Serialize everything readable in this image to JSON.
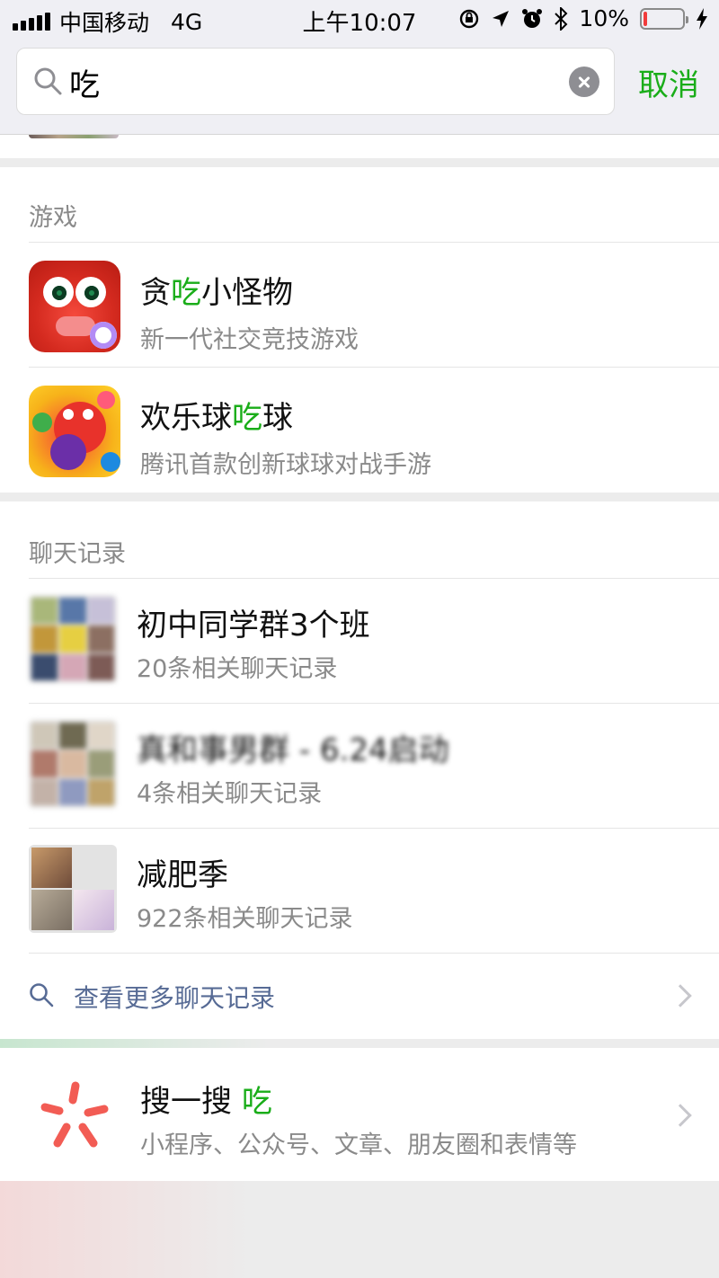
{
  "status_bar": {
    "carrier": "中国移动",
    "network": "4G",
    "time": "上午10:07",
    "battery": "10%",
    "battery_level": 0.1,
    "icons": [
      "signal-icon",
      "rotation-lock-icon",
      "location-icon",
      "alarm-icon",
      "bluetooth-icon",
      "battery-icon",
      "charging-icon"
    ]
  },
  "search": {
    "query": "吃",
    "cancel_label": "取消"
  },
  "games": {
    "title": "游戏",
    "items": [
      {
        "name_before": "贪",
        "name_highlight": "吃",
        "name_after": "小怪物",
        "desc": "新一代社交竞技游戏"
      },
      {
        "name_before": "欢乐球",
        "name_highlight": "吃",
        "name_after": "球",
        "desc": "腾讯首款创新球球对战手游"
      }
    ]
  },
  "chats": {
    "title": "聊天记录",
    "items": [
      {
        "name": "初中同学群3个班",
        "desc": "20条相关聊天记录"
      },
      {
        "name": "真和事男群 - 6.24启动",
        "desc": "4条相关聊天记录"
      },
      {
        "name": "减肥季",
        "desc": "922条相关聊天记录"
      }
    ],
    "more_label": "查看更多聊天记录"
  },
  "sousou": {
    "label": "搜一搜",
    "query": "吃",
    "desc": "小程序、公众号、文章、朋友圈和表情等"
  },
  "colors": {
    "accent_green": "#1aad19",
    "link_blue": "#576b95",
    "secondary_text": "#8a8a8a",
    "background": "#ececec"
  }
}
